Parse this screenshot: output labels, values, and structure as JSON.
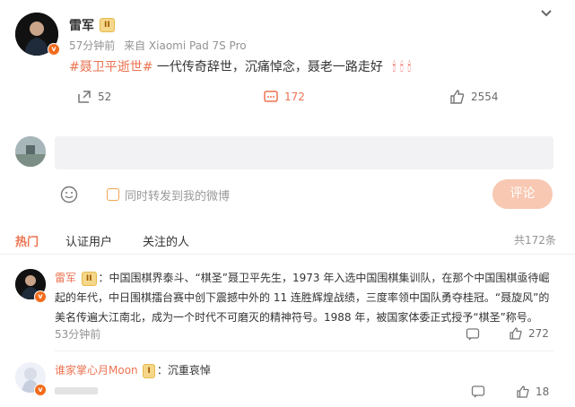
{
  "post": {
    "author": "雷军",
    "time": "57分钟前",
    "source": "来自 Xiaomi Pad 7S Pro",
    "hashtag": "#聂卫平逝世#",
    "text": " 一代传奇辞世，沉痛悼念，聂老一路走好",
    "reposts": "52",
    "comments": "172",
    "likes": "2554",
    "level": "II"
  },
  "composer": {
    "placeholder": "",
    "also_repost_label": "同时转发到我的微博",
    "submit_label": "评论"
  },
  "tabs": [
    {
      "label": "热门"
    },
    {
      "label": "认证用户"
    },
    {
      "label": "关注的人"
    }
  ],
  "total_count": "共172条",
  "comments": [
    {
      "author": "雷军",
      "level": "II",
      "text": "：中国围棋界泰斗、“棋圣”聂卫平先生，1973 年入选中国围棋集训队，在那个中国围棋亟待崛起的年代，中日围棋擂台赛中创下震撼中外的 11 连胜辉煌战绩，三度率领中国队勇夺桂冠。“聂旋风”的美名传遍大江南北，成为一个时代不可磨灭的精神符号。1988 年，被国家体委正式授予“棋圣”称号。",
      "time": "53分钟前",
      "likes": "272"
    },
    {
      "author": "谁家掌心月Moon",
      "level": "I",
      "text": "：沉重哀悼",
      "likes": "18"
    }
  ],
  "colors": {
    "accent": "#eb7350",
    "submit_bg": "#f8c8b2",
    "badge": "#f5d78a"
  }
}
